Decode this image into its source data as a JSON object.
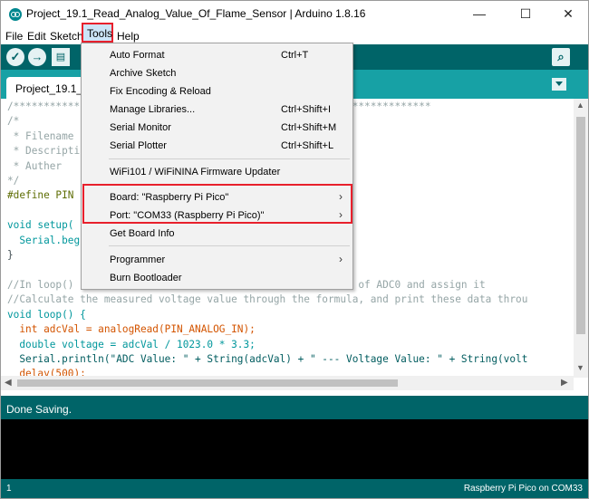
{
  "window": {
    "title": "Project_19.1_Read_Analog_Value_Of_Flame_Sensor | Arduino 1.8.16",
    "minimize": "—",
    "maximize": "☐",
    "close": "✕"
  },
  "menubar": {
    "items": [
      "File",
      "Edit",
      "Sketch",
      "Tools",
      "Help"
    ],
    "active": "Tools"
  },
  "toolbar": {
    "buttons": [
      "verify-icon",
      "upload-icon",
      "new-icon"
    ],
    "serial_monitor": "serial-monitor-icon"
  },
  "tabs": {
    "active": "Project_19.1_F"
  },
  "editor": {
    "lines": [
      "/*********************************************************************",
      "/*",
      " * Filename",
      " * Descripti",
      " * Auther",
      "*/",
      "#define PIN                                       sor",
      "",
      "void setup(",
      "  Serial.beg",
      "}",
      "",
      "//In loop()                                   e ADC value of ADC0 and assign it",
      "//Calculate the measured voltage value through the formula, and print these data throu",
      "void loop() {",
      "  int adcVal = analogRead(PIN_ANALOG_IN);",
      "  double voltage = adcVal / 1023.0 * 3.3;",
      "  Serial.println(\"ADC Value: \" + String(adcVal) + \" --- Voltage Value: \" + String(volt",
      "  delay(500);"
    ]
  },
  "tools_menu": {
    "items": [
      {
        "label": "Auto Format",
        "shortcut": "Ctrl+T"
      },
      {
        "label": "Archive Sketch",
        "shortcut": ""
      },
      {
        "label": "Fix Encoding & Reload",
        "shortcut": ""
      },
      {
        "label": "Manage Libraries...",
        "shortcut": "Ctrl+Shift+I"
      },
      {
        "label": "Serial Monitor",
        "shortcut": "Ctrl+Shift+M"
      },
      {
        "label": "Serial Plotter",
        "shortcut": "Ctrl+Shift+L"
      },
      {
        "label": "WiFi101 / WiFiNINA Firmware Updater",
        "shortcut": ""
      },
      {
        "label": "Board: \"Raspberry Pi Pico\"",
        "shortcut": "",
        "submenu": true
      },
      {
        "label": "Port: \"COM33 (Raspberry Pi Pico)\"",
        "shortcut": "",
        "submenu": true
      },
      {
        "label": "Get Board Info",
        "shortcut": ""
      },
      {
        "label": "Programmer",
        "shortcut": "",
        "submenu": true
      },
      {
        "label": "Burn Bootloader",
        "shortcut": ""
      }
    ],
    "submenu_arrow": "›"
  },
  "status": {
    "message": "Done Saving.",
    "line_number": "1",
    "board_port": "Raspberry Pi Pico on COM33"
  },
  "colors": {
    "toolbar": "#006468",
    "tabstrip": "#17a1a5",
    "highlight": "#e8202c"
  }
}
